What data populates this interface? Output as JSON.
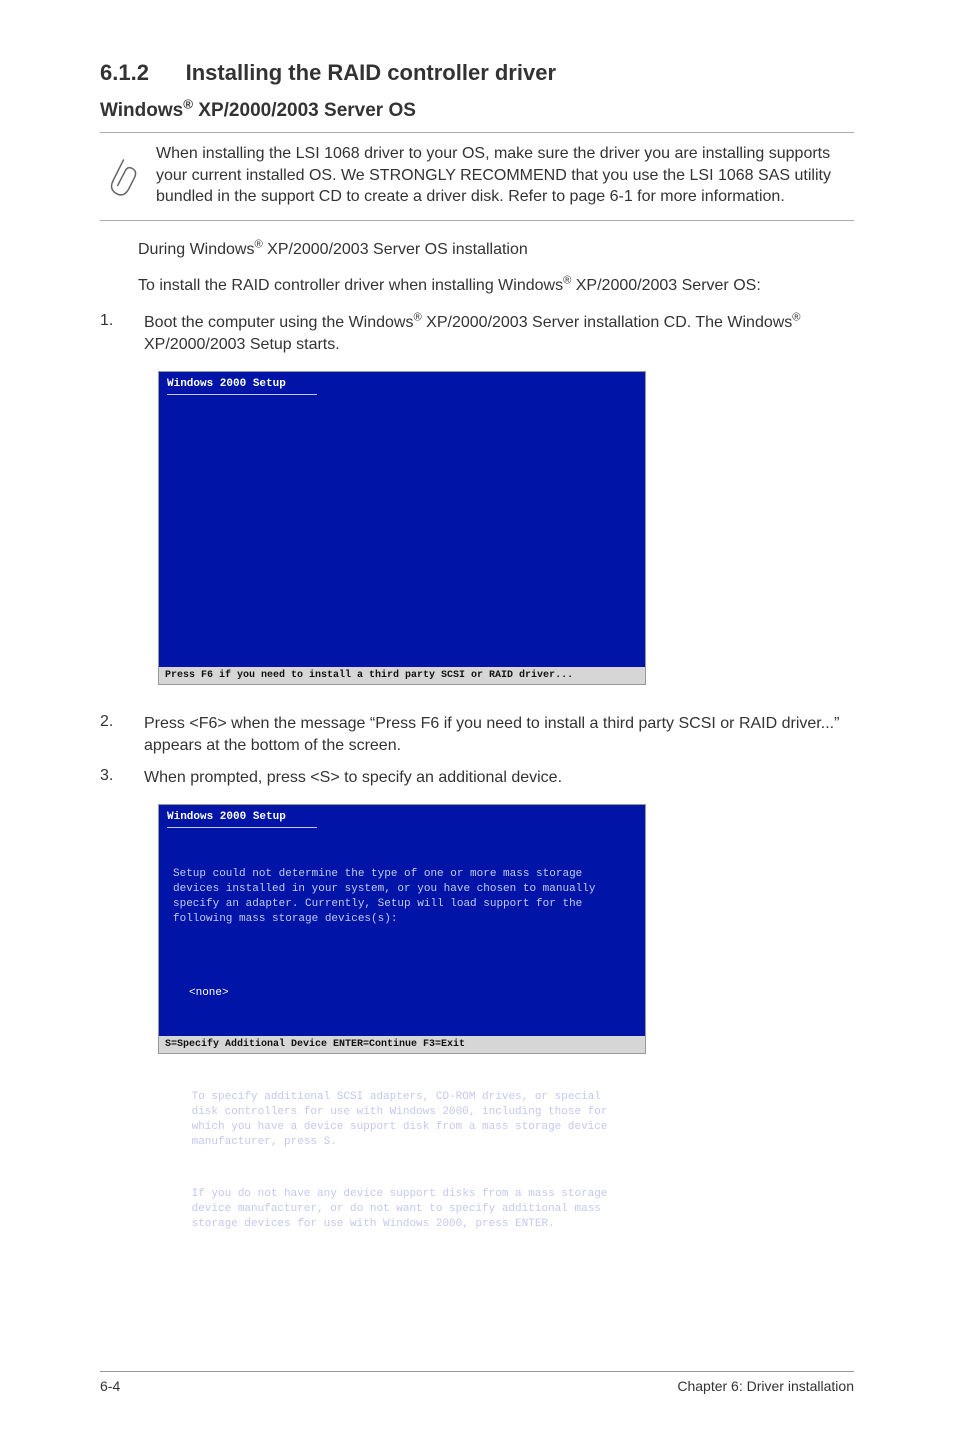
{
  "heading": {
    "number": "6.1.2",
    "title": "Installing the RAID controller driver"
  },
  "subheading": {
    "prefix": "Windows",
    "reg": "®",
    "suffix": " XP/2000/2003 Server OS"
  },
  "note": "When installing the LSI 1068 driver to your OS, make sure the driver you are installing supports your current installed OS. We STRONGLY RECOMMEND that you use the LSI 1068 SAS utility bundled in the support CD to create a driver disk. Refer to page 6-1 for more information.",
  "para1": {
    "a": "During Windows",
    "reg": "®",
    "b": " XP/2000/2003 Server OS installation"
  },
  "para2": {
    "a": "To install the RAID controller driver when installing Windows",
    "reg": "®",
    "b": " XP/2000/2003 Server OS:"
  },
  "steps": {
    "s1": {
      "num": "1.",
      "a": "Boot the computer using the Windows",
      "reg1": "®",
      "b": " XP/2000/2003 Server installation CD. The Windows",
      "reg2": "®",
      "c": " XP/2000/2003 Setup starts."
    },
    "s2": {
      "num": "2.",
      "text": "Press <F6> when the message “Press F6 if you need to install a third party SCSI or RAID driver...” appears at the bottom of the screen."
    },
    "s3": {
      "num": "3.",
      "text": "When prompted, press <S> to specify an additional device."
    }
  },
  "screenshot1": {
    "title": "Windows 2000 Setup",
    "bottom": "Press F6 if you need to install a third party SCSI or RAID driver..."
  },
  "screenshot2": {
    "title": "Windows 2000 Setup",
    "intro": "Setup could not determine the type of one or more mass storage devices installed in your system, or you have chosen to manually specify an adapter. Currently, Setup will load support for the following mass storage devices(s):",
    "none": "<none>",
    "bullet1": "To specify additional SCSI adapters, CD-ROM drives, or special disk controllers for use with Windows 2000, including those for which you have a device support disk from a mass storage device manufacturer, press S.",
    "bullet2": "If you do not have any device support disks from a mass storage device manufacturer, or do not want to specify additional mass storage devices for use with Windows 2000, press ENTER.",
    "bottom": "S=Specify Additional Device   ENTER=Continue   F3=Exit"
  },
  "footer": {
    "left": "6-4",
    "right": "Chapter 6: Driver installation"
  }
}
